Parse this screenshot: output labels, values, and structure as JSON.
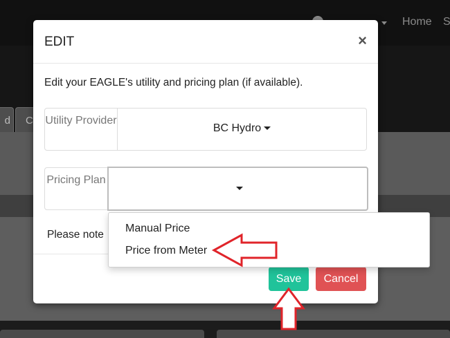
{
  "navbar": {
    "user_label": "",
    "home_label": "Home",
    "partial_label": "S"
  },
  "background_tabs": [
    {
      "label": "d"
    },
    {
      "label": "C"
    }
  ],
  "modal": {
    "title": "EDIT",
    "close_symbol": "×",
    "description": "Edit your EAGLE's utility and pricing plan (if available).",
    "utility_provider": {
      "label": "Utility Provider",
      "value": "BC Hydro"
    },
    "pricing_plan": {
      "label": "Pricing Plan",
      "value": ""
    },
    "note_partial": "Please note",
    "buttons": {
      "save": "Save",
      "cancel": "Cancel"
    }
  },
  "pricing_dropdown": {
    "options": [
      "Manual Price",
      "Price from Meter"
    ]
  },
  "colors": {
    "save": "#20c39a",
    "cancel": "#e05254",
    "annotation_arrow": "#e0242a"
  }
}
